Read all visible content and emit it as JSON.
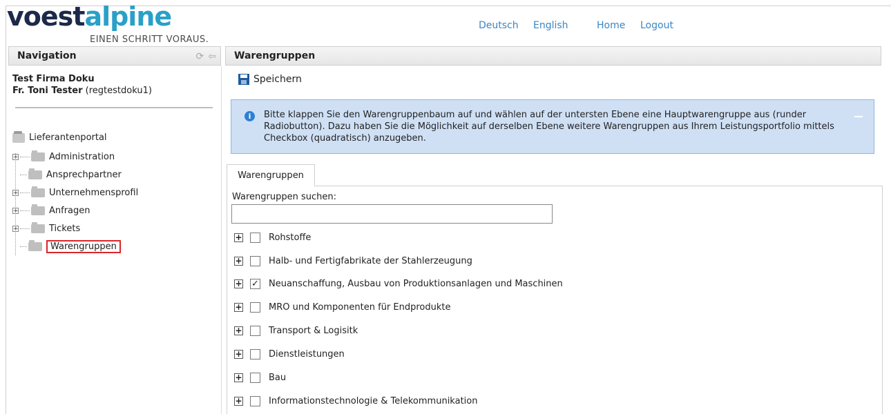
{
  "logo": {
    "part1": "voest",
    "part2": "alpine",
    "tagline": "EINEN SCHRITT VORAUS."
  },
  "topnav": {
    "deutsch": "Deutsch",
    "english": "English",
    "home": "Home",
    "logout": "Logout"
  },
  "nav": {
    "title": "Navigation",
    "company": "Test Firma Doku",
    "user_name": "Fr. Toni Tester",
    "user_id": "(regtestdoku1)",
    "root": "Lieferantenportal",
    "items": [
      {
        "label": "Administration"
      },
      {
        "label": "Ansprechpartner"
      },
      {
        "label": "Unternehmensprofil"
      },
      {
        "label": "Anfragen"
      },
      {
        "label": "Tickets"
      },
      {
        "label": "Warengruppen"
      }
    ]
  },
  "content": {
    "title": "Warengruppen",
    "save_label": "Speichern",
    "info_text": "Bitte klappen Sie den Warengruppenbaum auf und wählen auf der untersten Ebene eine Hauptwarengruppe aus (runder Radiobutton). Dazu haben Sie die Möglichkeit auf derselben Ebene weitere Warengruppen aus Ihrem Leistungsportfolio mittels Checkbox (quadratisch) anzugeben.",
    "tab_label": "Warengruppen",
    "search_label": "Warengruppen suchen:",
    "search_value": "",
    "groups": [
      {
        "label": "Rohstoffe",
        "checked": ""
      },
      {
        "label": "Halb- und Fertigfabrikate der Stahlerzeugung",
        "checked": ""
      },
      {
        "label": "Neuanschaffung, Ausbau von Produktionsanlagen und Maschinen",
        "checked": "✓"
      },
      {
        "label": "MRO und Komponenten für Endprodukte",
        "checked": ""
      },
      {
        "label": "Transport & Logisitk",
        "checked": ""
      },
      {
        "label": "Dienstleistungen",
        "checked": ""
      },
      {
        "label": "Bau",
        "checked": ""
      },
      {
        "label": "Informationstechnologie & Telekommunikation",
        "checked": ""
      }
    ]
  },
  "colors": {
    "accent": "#3a86c4",
    "info_bg": "#cfe0f5",
    "highlight": "#d9252b"
  }
}
